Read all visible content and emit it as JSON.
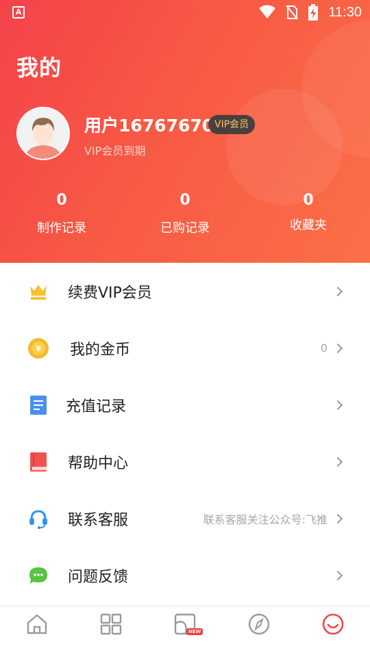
{
  "status_bar": {
    "app_icon_letter": "A",
    "time": "11:30"
  },
  "header": {
    "title": "我的",
    "username": "用户16767670",
    "vip_badge": "VIP会员",
    "vip_status": "VIP会员到期"
  },
  "stats": [
    {
      "value": "0",
      "label": "制作记录"
    },
    {
      "value": "0",
      "label": "已购记录"
    },
    {
      "value": "0",
      "label": "收藏夹"
    }
  ],
  "menu": [
    {
      "icon": "crown-icon",
      "label": "续费VIP会员",
      "extra": ""
    },
    {
      "icon": "coin-icon",
      "label": "我的金币",
      "extra": "0"
    },
    {
      "icon": "document-icon",
      "label": "充值记录",
      "extra": ""
    },
    {
      "icon": "book-icon",
      "label": "帮助中心",
      "extra": ""
    },
    {
      "icon": "headset-icon",
      "label": "联系客服",
      "extra": "联系客服关注公众号:飞推"
    },
    {
      "icon": "chat-bubble-icon",
      "label": "问题反馈",
      "extra": ""
    }
  ],
  "tabbar": {
    "tabs": [
      "home-icon",
      "grid-icon",
      "template-icon",
      "compass-icon",
      "profile-icon"
    ],
    "new_tag": "NEW",
    "active_tab": "profile-icon"
  },
  "colors": {
    "header_start": "#f5424a",
    "header_end": "#fb6f47",
    "vip_badge_bg": "#4a3f3d",
    "vip_badge_text": "#f2c66b",
    "active_tab": "#f04848"
  }
}
